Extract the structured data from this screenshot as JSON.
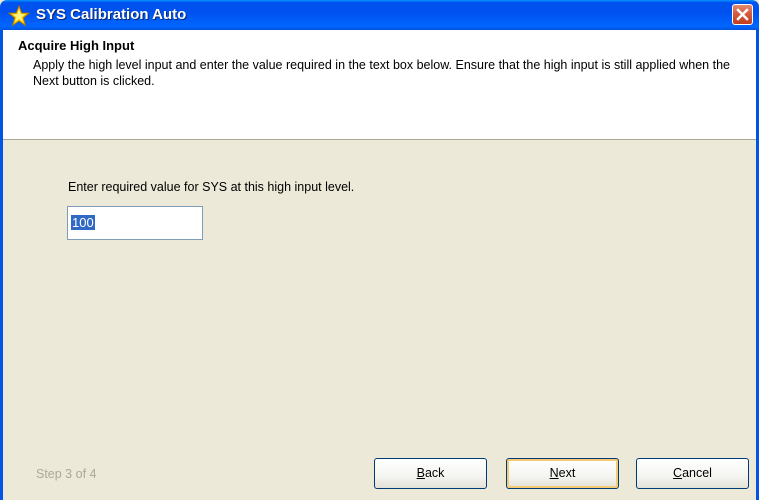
{
  "window": {
    "title": "SYS Calibration Auto",
    "icon": "star-icon",
    "close_icon": "close-icon",
    "titlebar_color": "#0055e5",
    "close_color": "#d55b3e"
  },
  "header": {
    "title": "Acquire High Input",
    "description": "Apply the high level input and enter the value required in the text box below. Ensure that the high input is still applied when the Next button is clicked."
  },
  "form": {
    "prompt": "Enter required value for SYS at this high input level.",
    "value": "100",
    "selection_color": "#316ac5"
  },
  "footer": {
    "step": "Step 3 of 4",
    "buttons": {
      "back": {
        "first": "B",
        "rest": "ack"
      },
      "next": {
        "first": "N",
        "rest": "ext"
      },
      "cancel": {
        "first": "C",
        "rest": "ancel"
      }
    }
  }
}
